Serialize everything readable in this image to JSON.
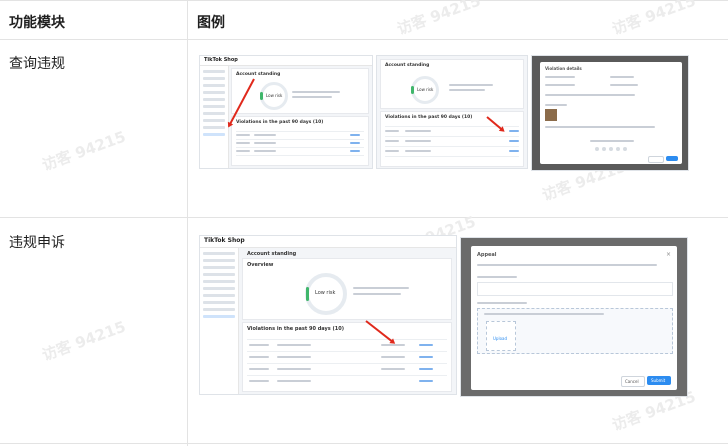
{
  "table": {
    "headers": {
      "module": "功能模块",
      "example": "图例"
    },
    "rows": [
      {
        "module": "查询违规"
      },
      {
        "module": "违规申诉"
      }
    ]
  },
  "watermark": "访客 94215",
  "thumbs": {
    "brand": "TikTok Shop",
    "account_standing": "Account standing",
    "overview": "Overview",
    "low_risk": "Low risk",
    "violations_title": "Violations in the past 90 days (10)",
    "appeal_title": "Appeal",
    "upload_label": "Upload",
    "cancel": "Cancel",
    "submit": "Submit"
  }
}
